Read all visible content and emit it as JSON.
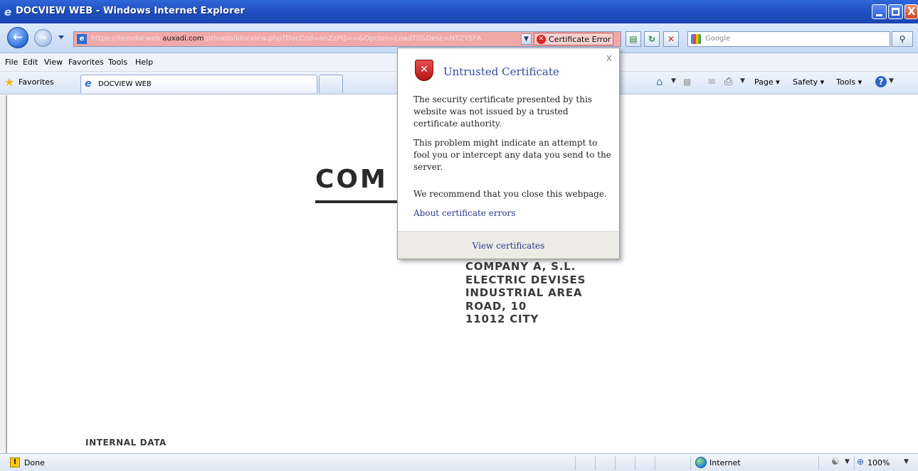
{
  "window": {
    "title": "DOCVIEW WEB - Windows Internet Explorer"
  },
  "address_bar": {
    "url_prefix": "https://itemdocweb.",
    "url_domain": "auxadi.com",
    "url_suffix": "/privado/idocview.php?DocCod=anZzPQ==&Opcion=LoadTif&Desc=NTZYSFA",
    "certificate_error_label": "Certificate Error",
    "search_placeholder": "Google"
  },
  "menu": {
    "items": [
      "File",
      "Edit",
      "View",
      "Favorites",
      "Tools",
      "Help"
    ]
  },
  "favorites_bar": {
    "favorites_label": "Favorites",
    "tab_label": "DOCVIEW WEB",
    "command_items": [
      "Page",
      "Safety",
      "Tools"
    ]
  },
  "page": {
    "heading_fragment": "COM",
    "address_lines": [
      "COMPANY A, S.L.",
      "ELECTRIC DEVISES",
      "INDUSTRIAL AREA",
      "ROAD, 10",
      "11012 CITY"
    ],
    "footer_text": "INTERNAL DATA"
  },
  "cert_popup": {
    "title": "Untrusted Certificate",
    "close_label": "x",
    "paragraph1": "The security certificate presented by this website was not issued by a trusted certificate authority.",
    "paragraph2": "This problem might indicate an attempt to fool you or intercept any data you send to the server.",
    "paragraph3": "We recommend that you close this webpage.",
    "link_label": "About certificate errors",
    "footer_button": "View certificates"
  },
  "status_bar": {
    "status_text": "Done",
    "zone_label": "Internet",
    "zoom_label": "100%"
  }
}
